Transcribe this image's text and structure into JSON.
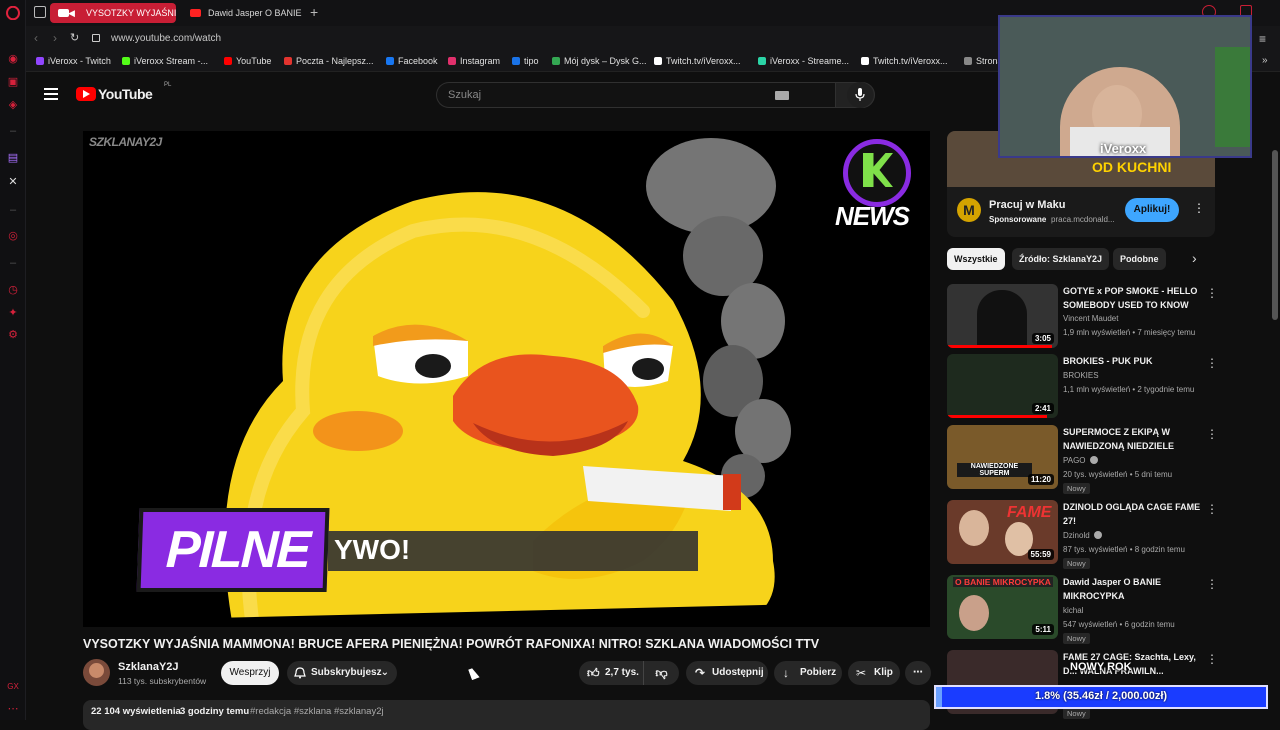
{
  "browser": {
    "tabs": [
      {
        "label": "VYSOTZKY WYJAŚNIA"
      },
      {
        "label": "Dawid Jasper O BANIE M"
      }
    ],
    "url": "www.youtube.com/watch",
    "bookmarks": [
      {
        "label": "iVeroxx - Twitch",
        "color": "#9146ff"
      },
      {
        "label": "iVeroxx Stream -...",
        "color": "#53fc18"
      },
      {
        "label": "YouTube",
        "color": "#ff0000"
      },
      {
        "label": "Poczta - Najlepsz...",
        "color": "#e3342f"
      },
      {
        "label": "Facebook",
        "color": "#1877f2"
      },
      {
        "label": "Instagram",
        "color": "#e1306c"
      },
      {
        "label": "tipo",
        "color": "#1a73e8"
      },
      {
        "label": "Mój dysk – Dysk G...",
        "color": "#34a853"
      },
      {
        "label": "Twitch.tv/iVeroxx...",
        "color": "#ffffff"
      },
      {
        "label": "iVeroxx - Streame...",
        "color": "#2bd4a6"
      },
      {
        "label": "Twitch.tv/iVeroxx...",
        "color": "#ffffff"
      },
      {
        "label": "Strona",
        "color": "#888888"
      }
    ]
  },
  "youtube": {
    "logo_text": "YouTube",
    "logo_region": "PL",
    "search_placeholder": "Szukaj"
  },
  "video": {
    "watermark": "SZKLANAY2J",
    "news_label": "NEWS",
    "banner_label": "PILNE",
    "banner_text": "YWO!",
    "title": "VYSOTZKY WYJAŚNIA MAMMONA! BRUCE AFERA PIENIĘŻNA! POWRÓT RAFONIXA! NITRO! SZKLANA WIADOMOŚCI TTV",
    "channel_name": "SzklanaY2J",
    "subscribers": "113 tys. subskrybentów",
    "support_label": "Wesprzyj",
    "subscribed_label": "Subskrybujesz",
    "likes": "2,7 tys.",
    "share_label": "Udostępnij",
    "download_label": "Pobierz",
    "clip_label": "Klip",
    "views": "22 104 wyświetlenia",
    "age": "3 godziny temu",
    "tags": "#redakcja #szklana #szklanay2j"
  },
  "ad": {
    "thumb_text": "OD KUCHNI",
    "title": "Pracuj w Maku",
    "sponsored": "Sponsorowane",
    "domain": "praca.mcdonald...",
    "cta": "Aplikuj!"
  },
  "filters": [
    "Wszystkie",
    "Źródło: SzklanaY2J",
    "Podobne"
  ],
  "related": [
    {
      "title": "GOTYE x POP SMOKE - HELLO SOMEBODY USED TO KNOW",
      "channel": "Vincent Maudet",
      "meta": "1,9 mln wyświetleń • 7 miesięcy temu",
      "duration": "3:05",
      "badge": "",
      "progress": 0.95,
      "thumb": "#333333"
    },
    {
      "title": "BROKIES - PUK PUK",
      "channel": "BROKIES",
      "meta": "1,1 mln wyświetleń • 2 tygodnie temu",
      "duration": "2:41",
      "badge": "",
      "progress": 0.9,
      "thumb": "#1e2a1e"
    },
    {
      "title": "SUPERMOCE Z EKIPĄ W NAWIEDZONĄ NIEDZIELE",
      "channel": "PAGO",
      "meta": "20 tys. wyświetleń • 5 dni temu",
      "duration": "11:20",
      "badge": "Nowy",
      "progress": 0,
      "thumb": "#7a5a2a",
      "thumb_text": "NAWIEDZONE SUPERM"
    },
    {
      "title": "DZINOLD OGLĄDA CAGE FAME 27!",
      "channel": "Dzinold",
      "meta": "87 tys. wyświetleń • 8 godzin temu",
      "duration": "55:59",
      "badge": "Nowy",
      "progress": 0,
      "thumb": "#6a3a2a",
      "thumb_text": "FAME"
    },
    {
      "title": "Dawid Jasper O BANIE MIKROCYPKA",
      "channel": "kichal",
      "meta": "547 wyświetleń • 6 godzin temu",
      "duration": "5:11",
      "badge": "Nowy",
      "progress": 0,
      "thumb": "#2a4a2a",
      "thumb_text": "O BANIE MIKROCYPKA"
    },
    {
      "title": "FAME 27 CAGE: Szachta, Lexy, D... WALNA PRAWILN...",
      "channel": "",
      "meta": "",
      "duration": "",
      "badge": "Nowy",
      "progress": 0,
      "thumb": "#3a2a2a"
    }
  ],
  "overlay": {
    "streamer": "iVeroxx",
    "goal_title": "NOWY ROK",
    "goal_progress": "1.8% (35.46zł / 2,000.00zł)",
    "goal_fraction": 0.018
  }
}
